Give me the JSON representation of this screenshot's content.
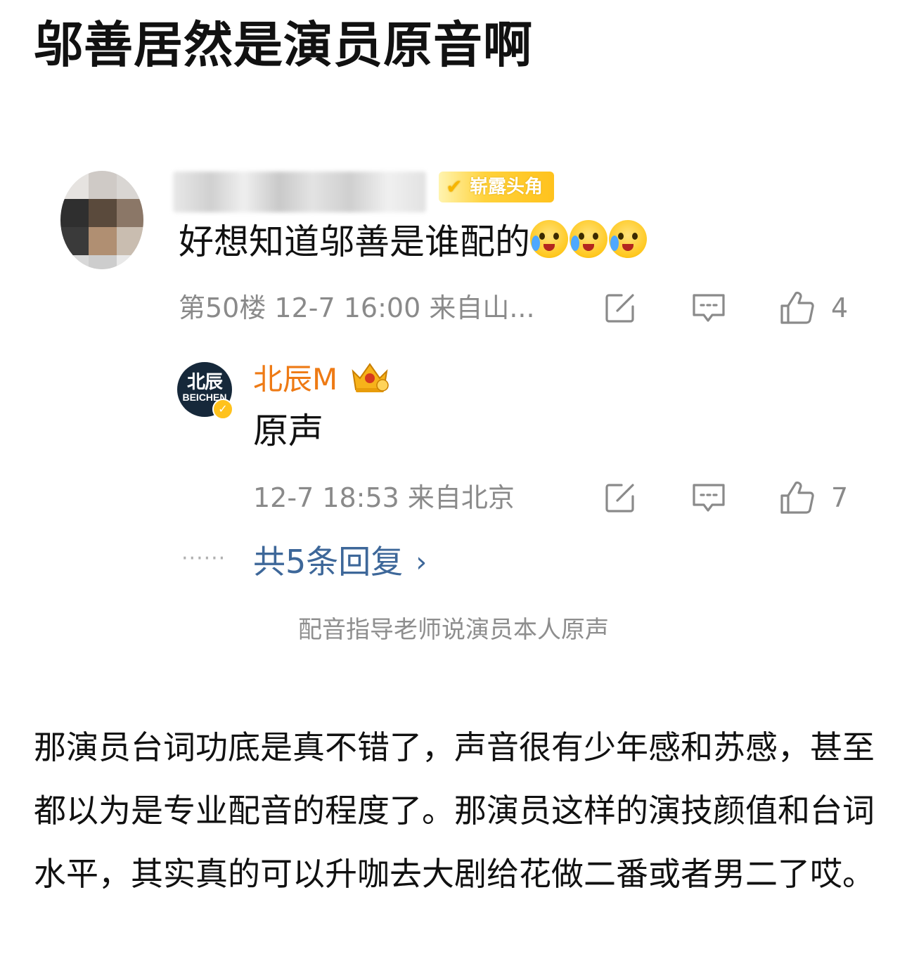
{
  "post": {
    "title": "邬善居然是演员原音啊",
    "body": "那演员台词功底是真不错了，声音很有少年感和苏感，甚至都以为是专业配音的程度了。那演员这样的演技颜值和台词水平，其实真的可以升咖去大剧给花做二番或者男二了哎。"
  },
  "screenshot": {
    "top_comment": {
      "user_badge": "崭露头角",
      "text": "好想知道邬善是谁配的",
      "emojis": [
        "crying-emoji",
        "crying-emoji",
        "crying-emoji"
      ],
      "meta": "第50楼  12-7 16:00  来自山...",
      "like_count": "4"
    },
    "reply": {
      "avatar_cn": "北辰",
      "avatar_en": "BEICHEN",
      "username": "北辰M",
      "text": "原声",
      "meta": "12-7 18:53  来自北京",
      "like_count": "7"
    },
    "more_replies": {
      "dots": "······",
      "label": "共5条回复"
    },
    "caption": "配音指导老师说演员本人原声"
  },
  "colors": {
    "username_orange": "#ee7a14",
    "link_blue": "#3d6799",
    "meta_gray": "#8a8a8a",
    "badge_gold": "#ffc21d"
  }
}
